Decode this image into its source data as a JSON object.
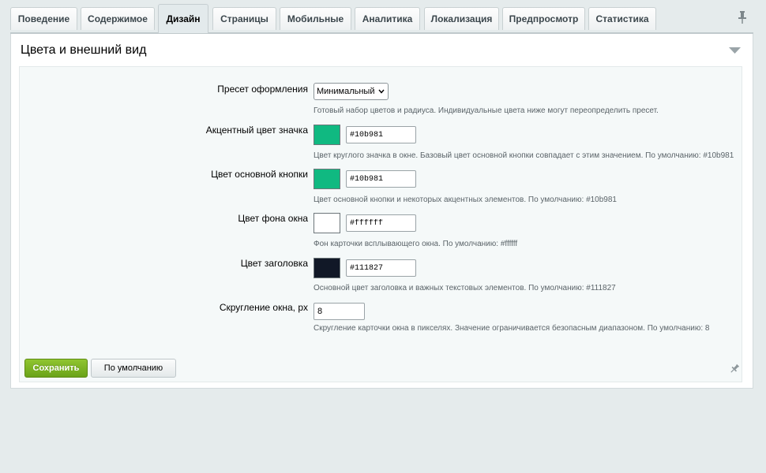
{
  "tabs": [
    {
      "label": "Поведение"
    },
    {
      "label": "Содержимое"
    },
    {
      "label": "Дизайн"
    },
    {
      "label": "Страницы"
    },
    {
      "label": "Мобильные"
    },
    {
      "label": "Аналитика"
    },
    {
      "label": "Локализация"
    },
    {
      "label": "Предпросмотр"
    },
    {
      "label": "Статистика"
    }
  ],
  "active_tab": "Дизайн",
  "icons": {
    "tab_pin": "pin-icon",
    "collapse": "triangle-down-icon",
    "footer_pin": "pin-icon"
  },
  "section": {
    "title": "Цвета и внешний вид"
  },
  "fields": {
    "preset": {
      "label": "Пресет оформления",
      "value": "Минимальный",
      "hint": "Готовый набор цветов и радиуса. Индивидуальные цвета ниже могут переопределить пресет."
    },
    "badge_color": {
      "label": "Акцентный цвет значка",
      "value": "#10b981",
      "swatch": "#10b981",
      "hint": "Цвет круглого значка в окне. Базовый цвет основной кнопки совпадает с этим значением. По умолчанию: #10b981"
    },
    "primary_button_color": {
      "label": "Цвет основной кнопки",
      "value": "#10b981",
      "swatch": "#10b981",
      "hint": "Цвет основной кнопки и некоторых акцентных элементов. По умолчанию: #10b981"
    },
    "window_bg_color": {
      "label": "Цвет фона окна",
      "value": "#ffffff",
      "swatch": "#ffffff",
      "hint": "Фон карточки всплывающего окна. По умолчанию: #ffffff"
    },
    "title_color": {
      "label": "Цвет заголовка",
      "value": "#111827",
      "swatch": "#111827",
      "hint": "Основной цвет заголовка и важных текстовых элементов. По умолчанию: #111827"
    },
    "radius": {
      "label": "Скругление окна, px",
      "value": "8",
      "hint": "Скругление карточки окна в пикселях. Значение ограничивается безопасным диапазоном. По умолчанию: 8"
    }
  },
  "buttons": {
    "save": "Сохранить",
    "reset": "По умолчанию"
  },
  "colors": {
    "save_button": "#7cb522",
    "page_background": "#e5ebec"
  }
}
